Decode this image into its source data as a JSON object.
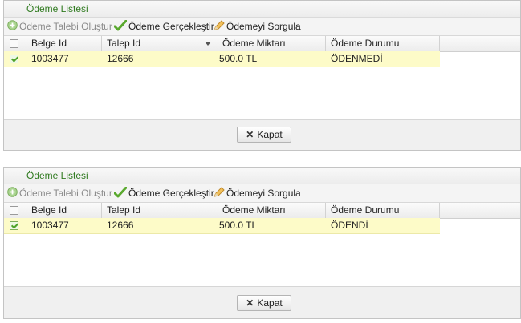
{
  "panels": [
    {
      "title": "Ödeme Listesi",
      "toolbar": {
        "create_label": "Ödeme Talebi Oluştur",
        "pay_label": "Ödeme Gerçekleştir",
        "query_label": "Ödemeyi Sorgula"
      },
      "columns": [
        "Belge Id",
        "Talep Id",
        "Ödeme Miktarı",
        "Ödeme Durumu"
      ],
      "rows": [
        {
          "checked": true,
          "belge_id": "1003477",
          "talep_id": "12666",
          "miktar": "500.0 TL",
          "durum": "ÖDENMEDİ"
        }
      ],
      "close_label": "Kapat"
    },
    {
      "title": "Ödeme Listesi",
      "toolbar": {
        "create_label": "Ödeme Talebi Oluştur",
        "pay_label": "Ödeme Gerçekleştir",
        "query_label": "Ödemeyi Sorgula"
      },
      "columns": [
        "Belge Id",
        "Talep Id",
        "Ödeme Miktarı",
        "Ödeme Durumu"
      ],
      "rows": [
        {
          "checked": true,
          "belge_id": "1003477",
          "talep_id": "12666",
          "miktar": "500.0 TL",
          "durum": "ÖDENDİ"
        }
      ],
      "close_label": "Kapat"
    }
  ],
  "icons": {
    "create": "add-circle-icon",
    "pay": "checkmark-icon",
    "query": "pencil-icon",
    "close": "close-x-icon",
    "sort": "sort-desc-icon"
  },
  "colors": {
    "title": "#2f7a1f",
    "selected_row": "#fdfbc8",
    "check_green": "#4fa32a"
  }
}
